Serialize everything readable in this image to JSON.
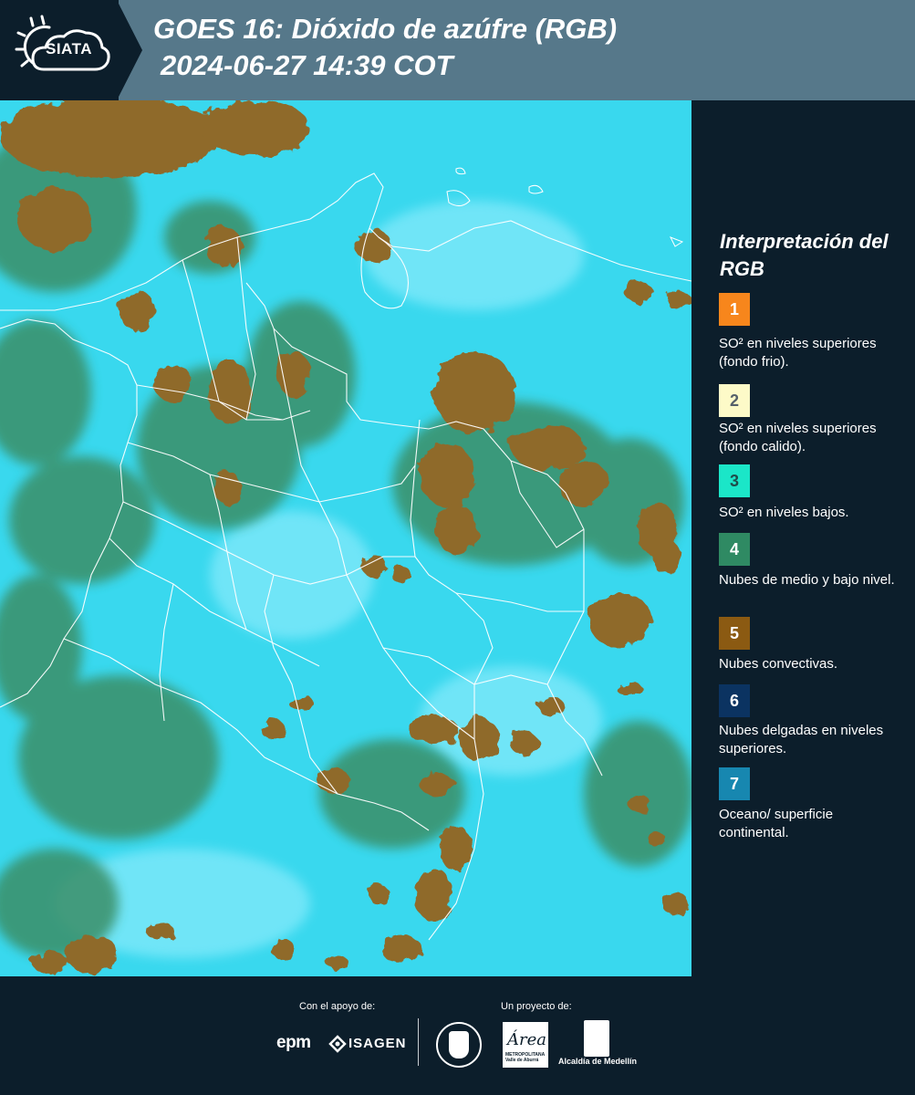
{
  "header": {
    "logo_text": "SIATA",
    "title_line1": "GOES 16: Dióxido de azúfre (RGB)",
    "title_line2": "2024-06-27 14:39 COT"
  },
  "legend": {
    "title": "Interpretación del RGB",
    "items": [
      {
        "num": "1",
        "label": "SO² en niveles superiores (fondo frio).",
        "color": "#f7861c",
        "text_color": "#ffffff"
      },
      {
        "num": "2",
        "label": "SO² en niveles superiores (fondo calido).",
        "color": "#fdfac8",
        "text_color": "#55606a"
      },
      {
        "num": "3",
        "label": "SO² en niveles bajos.",
        "color": "#1be6c8",
        "text_color": "#1f4c4a"
      },
      {
        "num": "4",
        "label": "Nubes de medio y bajo nivel.",
        "color": "#2f8a63",
        "text_color": "#ffffff"
      },
      {
        "num": "5",
        "label": "Nubes convectivas.",
        "color": "#8b5a12",
        "text_color": "#ffffff"
      },
      {
        "num": "6",
        "label": "Nubes delgadas en niveles superiores.",
        "color": "#0b3361",
        "text_color": "#ffffff"
      },
      {
        "num": "7",
        "label": "Oceano/ superficie continental.",
        "color": "#1787b0",
        "text_color": "#ffffff"
      }
    ]
  },
  "footer": {
    "support_label": "Con el apoyo de:",
    "project_label": "Un proyecto de:",
    "sponsor1": "epm",
    "sponsor2": "ISAGEN",
    "area_name": "Área",
    "area_sub": "METROPOLITANA Valle de Aburrá",
    "alcaldia": "Alcaldía de Medellín"
  },
  "colors": {
    "background": "#0c1e2b",
    "header_band": "#56788a",
    "map_base": "#39d8ee",
    "cloud_convective": "#8f6b2c",
    "cloud_low": "#3b8f68"
  }
}
